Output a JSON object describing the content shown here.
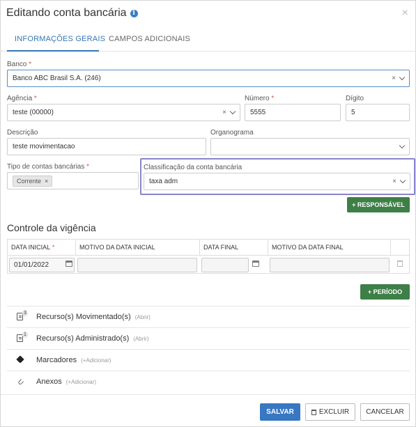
{
  "dialog": {
    "title": "Editando conta bancária",
    "info_icon": "i",
    "close_icon": "×"
  },
  "tabs": [
    {
      "label": "INFORMAÇÕES GERAIS",
      "active": true
    },
    {
      "label": "CAMPOS ADICIONAIS",
      "active": false
    }
  ],
  "form": {
    "banco": {
      "label": "Banco",
      "required": "*",
      "value": "Banco ABC Brasil S.A. (246)"
    },
    "agencia": {
      "label": "Agência",
      "required": "*",
      "value": "teste (00000)"
    },
    "numero": {
      "label": "Número",
      "required": "*",
      "value": "5555"
    },
    "digito": {
      "label": "Dígito",
      "value": "5"
    },
    "descricao": {
      "label": "Descrição",
      "value": "teste movimentacao"
    },
    "organograma": {
      "label": "Organograma",
      "value": ""
    },
    "tipo_contas": {
      "label": "Tipo de contas bancárias",
      "required": "*",
      "tag": "Corrente"
    },
    "classificacao": {
      "label": "Classificação da conta bancária",
      "value": "taxa adm"
    }
  },
  "buttons": {
    "responsavel": "+ RESPONSÁVEL",
    "periodo": "+ PERÍODO",
    "salvar": "SALVAR",
    "excluir": "EXCLUIR",
    "cancelar": "CANCELAR"
  },
  "vigencia": {
    "title": "Controle da vigência",
    "headers": [
      "DATA INICIAL",
      "MOTIVO DA DATA INICIAL",
      "DATA FINAL",
      "MOTIVO DA DATA FINAL"
    ],
    "header_required": "*",
    "row": {
      "data_inicial": "01/01/2022",
      "motivo_inicial": "",
      "data_final": "",
      "motivo_final": ""
    }
  },
  "resources": [
    {
      "label": "Recurso(s) Movimentado(s)",
      "badge": "3",
      "link": "(Abrir)",
      "icon": "document-icon"
    },
    {
      "label": "Recurso(s) Administrado(s)",
      "badge": "1",
      "link": "(Abrir)",
      "icon": "document-icon"
    },
    {
      "label": "Marcadores",
      "badge": "",
      "link": "(+Adicionar)",
      "icon": "tag-icon"
    },
    {
      "label": "Anexos",
      "badge": "",
      "link": "(+Adicionar)",
      "icon": "paperclip-icon"
    }
  ],
  "colors": {
    "primary": "#3877c2",
    "green": "#3e7f47",
    "tab_active": "#3576b6",
    "highlight": "#8a85c9",
    "required": "#d9534f"
  }
}
